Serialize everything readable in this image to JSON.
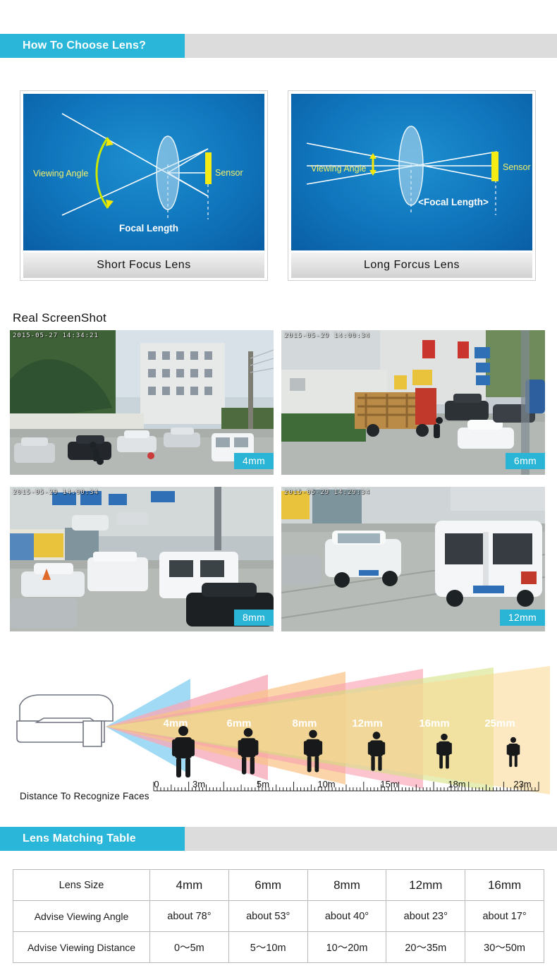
{
  "colors": {
    "accent_teal": "#29b6d8",
    "banner_gray": "#dcdcdc",
    "diagram_blue": "#1076bd",
    "sensor_yellow": "#f5ec16",
    "angle_green": "#c6e400"
  },
  "banners": {
    "choose_lens": "How To Choose Lens?",
    "matching_table": "Lens Matching Table"
  },
  "diagrams": [
    {
      "id": "short-focus",
      "caption": "Short Focus Lens",
      "labels": {
        "viewing_angle": "Viewing Angle",
        "sensor": "Sensor",
        "focal_length": "Focal Length"
      }
    },
    {
      "id": "long-focus",
      "caption": "Long Forcus Lens",
      "labels": {
        "viewing_angle": "Viewing Angle",
        "sensor": "Sensor",
        "focal_length": "<Focal Length>"
      }
    }
  ],
  "screenshot_section": {
    "title": "Real ScreenShot",
    "shots": [
      {
        "lens": "4mm",
        "timestamp": "2015-05-27  14:34:21"
      },
      {
        "lens": "6mm",
        "timestamp": "2015-05-29  14:00:34"
      },
      {
        "lens": "8mm",
        "timestamp": "2015-05-29  14:00:34"
      },
      {
        "lens": "12mm",
        "timestamp": "2015-05-29  14:29:34"
      }
    ]
  },
  "chart_data": {
    "type": "bar",
    "title": "Distance To Recognize Faces",
    "xlabel": "Distance To Recognize Faces",
    "ylabel": "",
    "grid": false,
    "legend": "inline-labels",
    "axis_label": "Distance To Recognize Faces",
    "categories": [
      "4mm",
      "6mm",
      "8mm",
      "12mm",
      "16mm",
      "25mm"
    ],
    "values": [
      3,
      5,
      10,
      15,
      18,
      23
    ],
    "unit": "m",
    "tick_labels": [
      "0",
      "3m",
      "5m",
      "10m",
      "15m",
      "18m",
      "23m"
    ],
    "tick_values": [
      0,
      3,
      5,
      10,
      15,
      18,
      23
    ],
    "xlim": [
      0,
      23
    ],
    "series": [
      {
        "name": "4mm",
        "reach_m": 3,
        "color": "#7ecdf0"
      },
      {
        "name": "6mm",
        "reach_m": 5,
        "color": "#f4899f"
      },
      {
        "name": "8mm",
        "reach_m": 10,
        "color": "#f6ab55"
      },
      {
        "name": "12mm",
        "reach_m": 15,
        "color": "#f57a93"
      },
      {
        "name": "16mm",
        "reach_m": 18,
        "color": "#c3d64f"
      },
      {
        "name": "25mm",
        "reach_m": 23,
        "color": "#f9cb6a"
      }
    ],
    "camera_icon": "bullet-camera",
    "people_count": 6
  },
  "table": {
    "columns": [
      "Lens Size",
      "4mm",
      "6mm",
      "8mm",
      "12mm",
      "16mm"
    ],
    "rows": [
      {
        "label": "Advise Viewing Angle",
        "values": [
          "about 78°",
          "about 53°",
          "about 40°",
          "about 23°",
          "about 17°"
        ]
      },
      {
        "label": "Advise Viewing Distance",
        "values": [
          "0～5m",
          "5～10m",
          "10～20m",
          "20～35m",
          "30～50m"
        ]
      }
    ]
  }
}
